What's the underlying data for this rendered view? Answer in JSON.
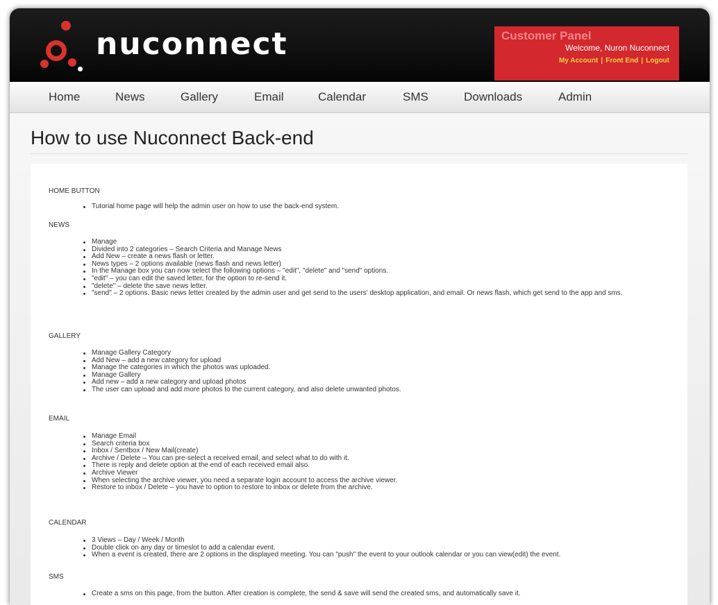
{
  "header": {
    "logo_text": "nuconnect",
    "customer_panel": {
      "title": "Customer Panel",
      "welcome": "Welcome, Nuron Nuconnect",
      "links": [
        "My Account",
        "Front End",
        "Logout"
      ]
    }
  },
  "nav": [
    "Home",
    "News",
    "Gallery",
    "Email",
    "Calendar",
    "SMS",
    "Downloads",
    "Admin"
  ],
  "page": {
    "title": "How to use Nuconnect Back-end"
  },
  "sections": [
    {
      "heading": "HOME BUTTON",
      "items": [
        "Tutorial home page will help the admin user on how to use the back-end system."
      ]
    },
    {
      "heading": "NEWS",
      "items": [
        "Manage",
        "Divided into 2 categories – Search Criteria and Manage News",
        "Add New – create a news flash or letter.",
        "News types – 2 options available (news flash and news letter)",
        "In the Manage box you can now select the following options – \"edit\", \"delete\" and \"send\" options.",
        "\"edit\" – you can edit the saved letter, for the option to re-send it.",
        "\"delete\" – delete the save news letter.",
        "\"send\" – 2 options. Basic news letter created by the admin user and get send to the users' desktop application, and email. Or news flash, which get send to the app and sms."
      ]
    },
    {
      "heading": "GALLERY",
      "items": [
        "Manage Gallery Category",
        "Add New – add a new category for upload",
        "Manage the categories in which the photos was uploaded.",
        "Manage Gallery",
        "Add new – add a new category and upload photos",
        "The user can upload and add more photos to the current category, and also delete unwanted photos."
      ]
    },
    {
      "heading": "EMAIL",
      "items": [
        "Manage Email",
        "Search criteria box",
        "Inbox / Sentbox / New Mail(create)",
        "Archive / Delete – You can pre-select a received email, and select what to do with it.",
        "There is reply and delete option at the end of each received email also.",
        "Archive Viewer",
        "When selecting the archive viewer, you need a separate login account to access the archive viewer.",
        "Restore to inbox / Delete – you have to option to restore to inbox or delete from the archive."
      ]
    },
    {
      "heading": "CALENDAR",
      "items": [
        "3 Views – Day / Week / Month",
        "Double click on any day or timeslot to add a calendar event.",
        "When a event is created, there are 2 options in the displayed meeting. You can \"push\" the event to your outlook calendar or you can view(edit) the event."
      ]
    },
    {
      "heading": "SMS",
      "items": [
        "Create a sms on this page, from the button. After creation is complete, the send & save will send the created sms, and automatically save it."
      ]
    }
  ],
  "colors": {
    "brand_red": "#d2282e",
    "link_yellow": "#f5d341",
    "header_black": "#111111"
  }
}
